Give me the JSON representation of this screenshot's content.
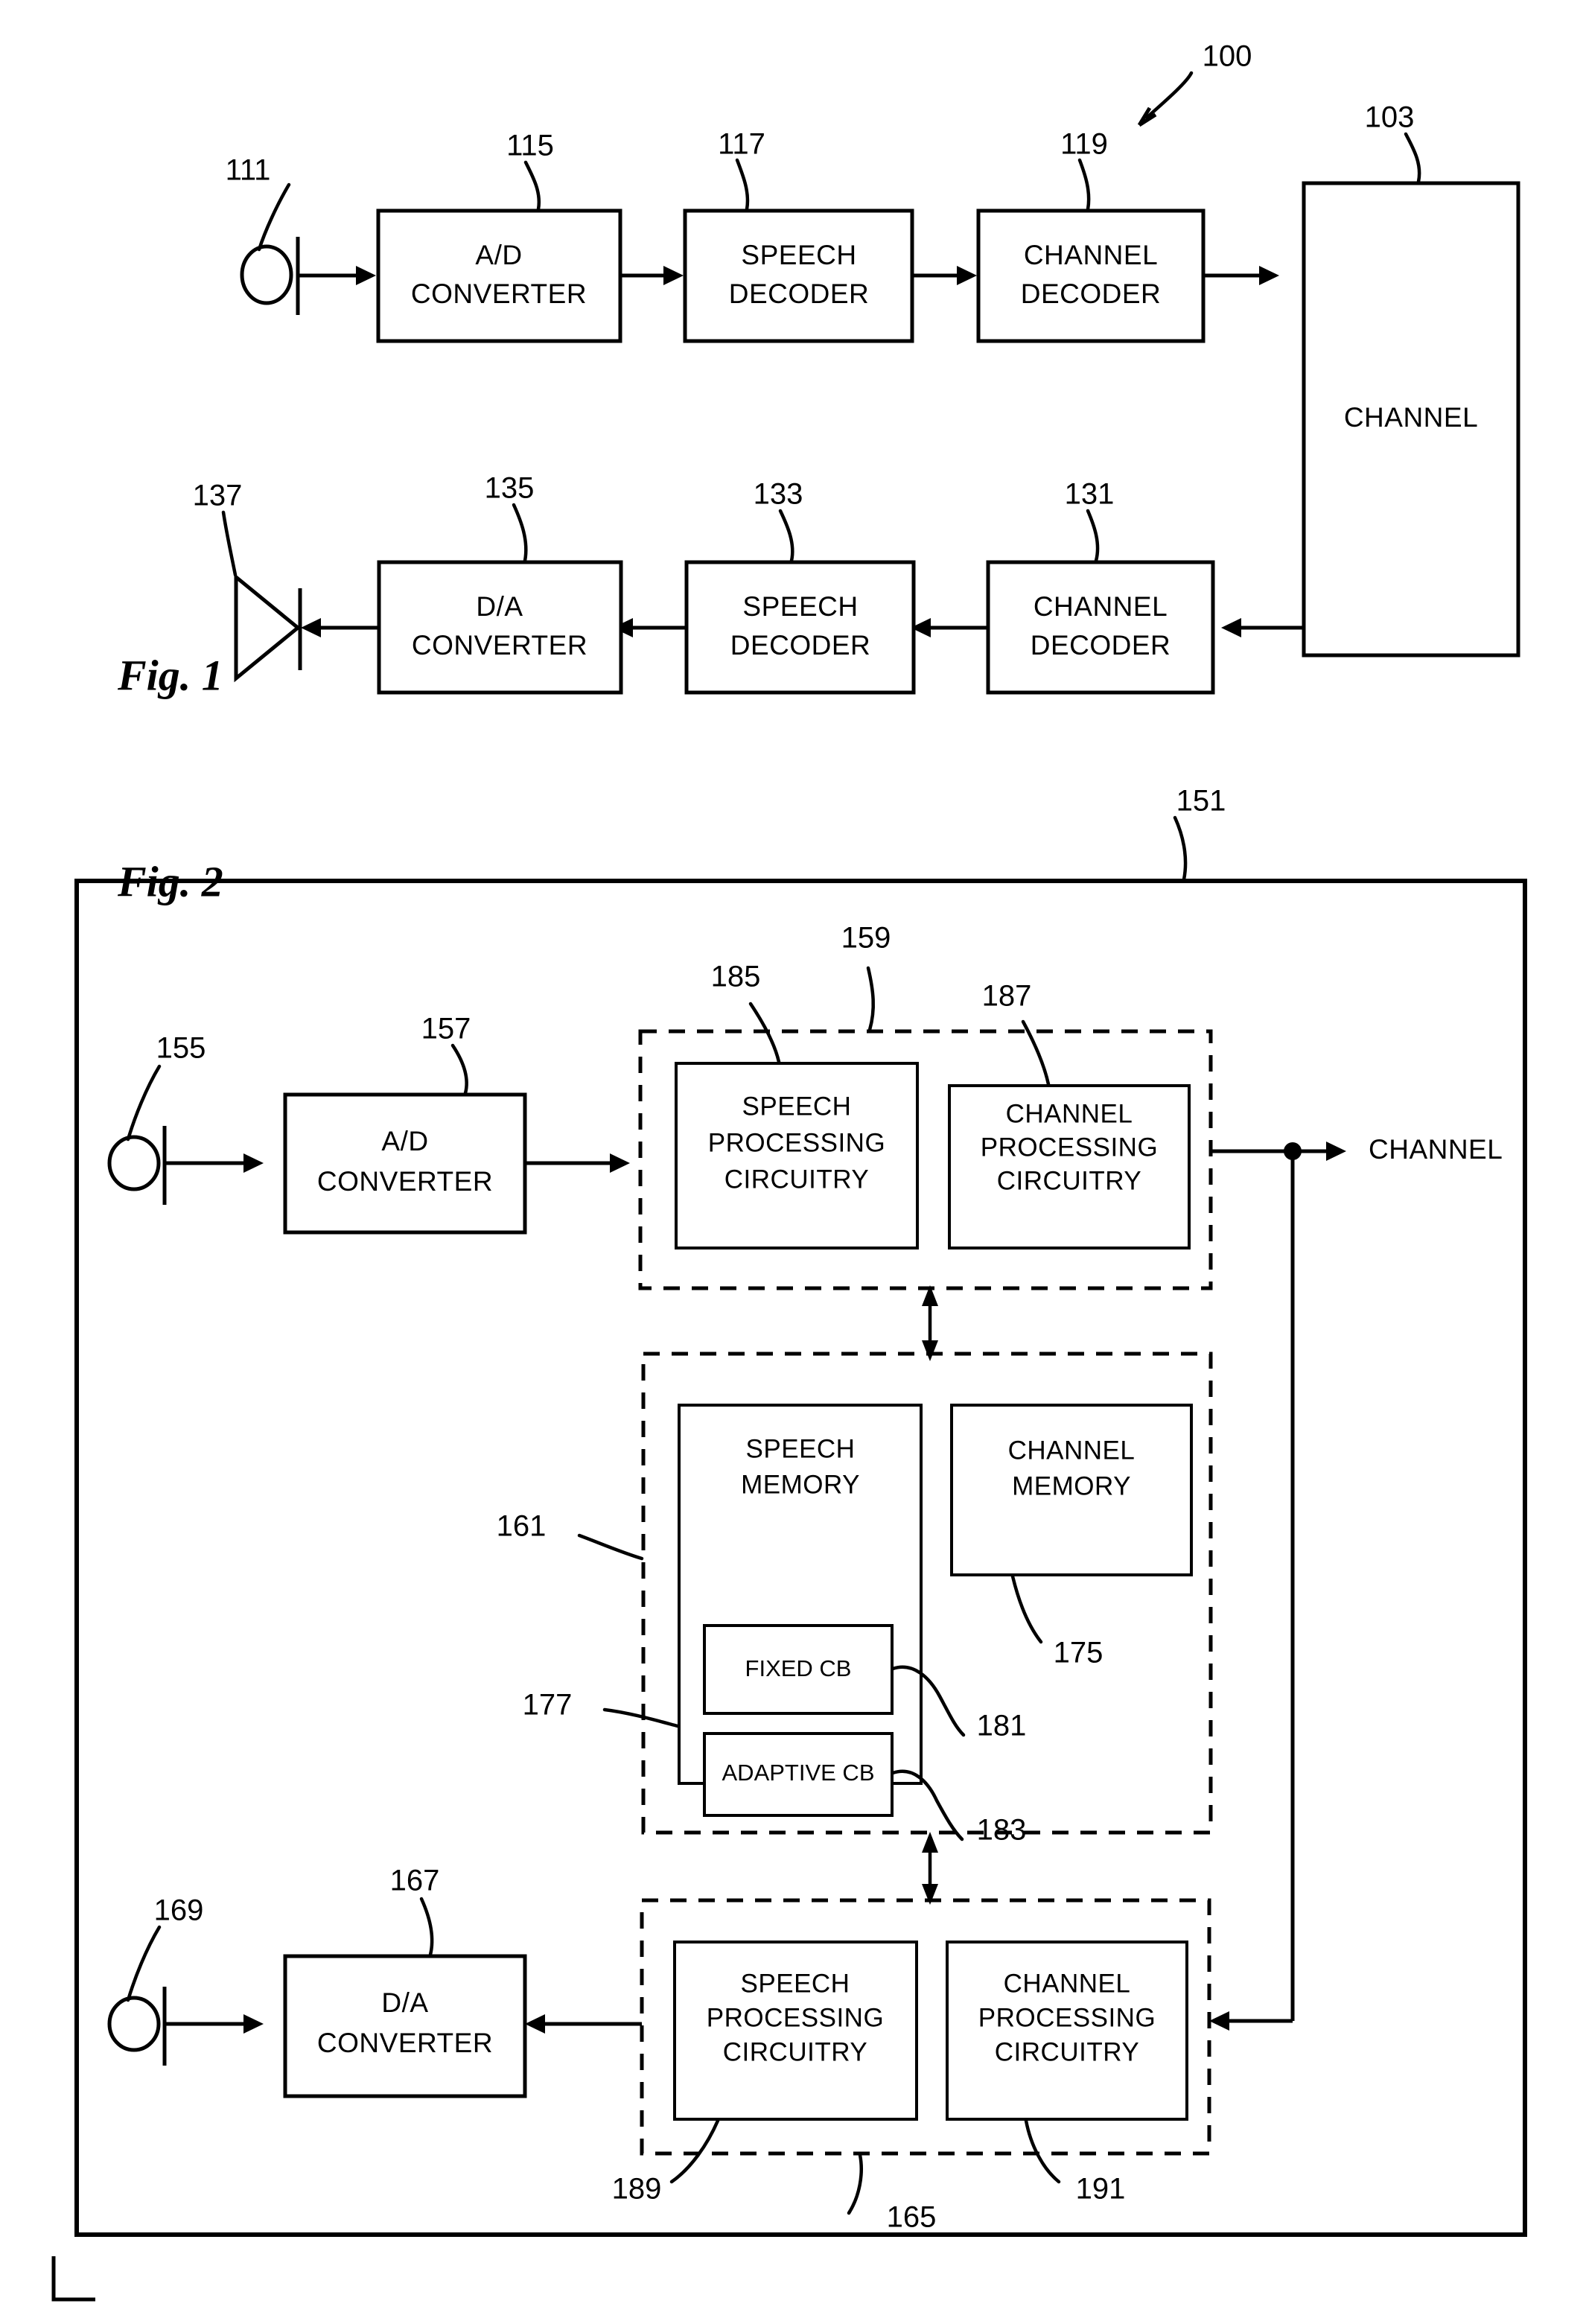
{
  "sheet": {
    "background": "#ffffff",
    "ink": "#000000",
    "corner_mark": "L"
  },
  "figures": [
    {
      "id": "fig1",
      "caption": "Fig. 1",
      "system_ref": "100",
      "encode_chain": {
        "source": {
          "ref": "111",
          "icon": "microphone-icon"
        },
        "blocks": [
          {
            "ref": "115",
            "line1": "A/D",
            "line2": "CONVERTER"
          },
          {
            "ref": "117",
            "line1": "SPEECH",
            "line2": "DECODER"
          },
          {
            "ref": "119",
            "line1": "CHANNEL",
            "line2": "DECODER"
          }
        ]
      },
      "channel_block": {
        "ref": "103",
        "label": "CHANNEL"
      },
      "decode_chain": {
        "sink": {
          "ref": "137",
          "icon": "speaker-icon"
        },
        "blocks": [
          {
            "ref": "135",
            "line1": "D/A",
            "line2": "CONVERTER"
          },
          {
            "ref": "133",
            "line1": "SPEECH",
            "line2": "DECODER"
          },
          {
            "ref": "131",
            "line1": "CHANNEL",
            "line2": "DECODER"
          }
        ]
      }
    },
    {
      "id": "fig2",
      "caption": "Fig. 2",
      "system_ref": "151",
      "channel_out_label": "CHANNEL",
      "input": {
        "ref": "155",
        "icon": "microphone-icon"
      },
      "ad_converter": {
        "ref": "157",
        "line1": "A/D",
        "line2": "CONVERTER"
      },
      "output": {
        "ref": "169",
        "icon": "microphone-icon"
      },
      "da_converter": {
        "ref": "167",
        "line1": "D/A",
        "line2": "CONVERTER"
      },
      "encode_group": {
        "ref": "159",
        "blocks": [
          {
            "ref": "185",
            "line1": "SPEECH",
            "line2": "PROCESSING",
            "line3": "CIRCUITRY"
          },
          {
            "ref": "187",
            "line1": "CHANNEL",
            "line2": "PROCESSING",
            "line3": "CIRCUITRY"
          }
        ]
      },
      "memory_group": {
        "ref": "161",
        "speech_memory": {
          "ref": "177",
          "line1": "SPEECH",
          "line2": "MEMORY",
          "codebooks": [
            {
              "ref": "181",
              "label": "FIXED CB"
            },
            {
              "ref": "183",
              "label": "ADAPTIVE CB"
            }
          ]
        },
        "channel_memory": {
          "ref": "175",
          "line1": "CHANNEL",
          "line2": "MEMORY"
        }
      },
      "decode_group": {
        "ref": "165",
        "blocks": [
          {
            "ref": "189",
            "line1": "SPEECH",
            "line2": "PROCESSING",
            "line3": "CIRCUITRY"
          },
          {
            "ref": "191",
            "line1": "CHANNEL",
            "line2": "PROCESSING",
            "line3": "CIRCUITRY"
          }
        ]
      }
    }
  ]
}
